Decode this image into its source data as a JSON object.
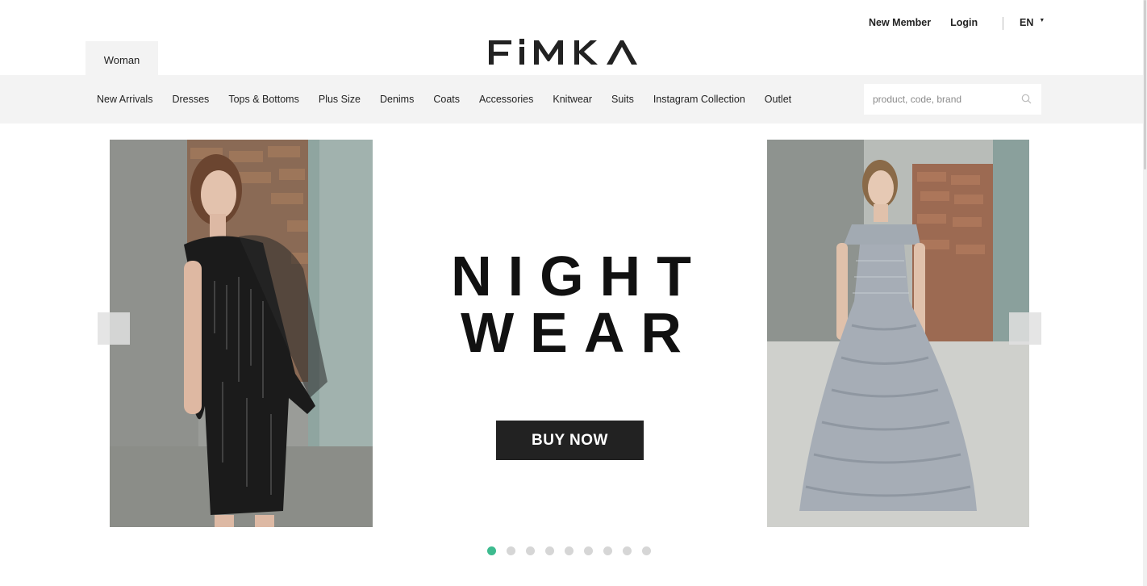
{
  "header": {
    "gender_tab": "Woman",
    "brand": "FIMKA",
    "new_member": "New Member",
    "login": "Login",
    "language": "EN"
  },
  "nav": {
    "items": [
      "New Arrivals",
      "Dresses",
      "Tops & Bottoms",
      "Plus Size",
      "Denims",
      "Coats",
      "Accessories",
      "Knitwear",
      "Suits",
      "Instagram Collection",
      "Outlet"
    ]
  },
  "search": {
    "placeholder": "product, code, brand",
    "value": "",
    "icon": "search-icon"
  },
  "hero": {
    "headline_line1": "NIGHT",
    "headline_line2": "WEAR",
    "cta": "BUY NOW",
    "left_photo": "model in black sequin one-shoulder dress",
    "right_photo": "model in grey ruffled off-shoulder gown",
    "slides_total": 9,
    "active_slide": 1
  },
  "colors": {
    "accent_dot": "#3dbb8f",
    "nav_bg": "#f3f3f3",
    "button_bg": "#222222"
  }
}
